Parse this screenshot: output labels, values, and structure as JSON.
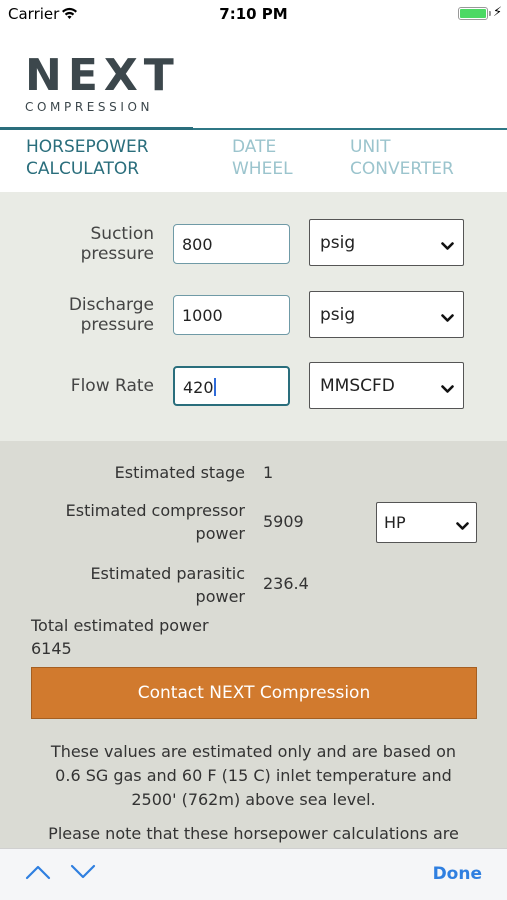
{
  "status_bar": {
    "carrier": "Carrier",
    "time": "7:10 PM",
    "charging_symbol": "⚡"
  },
  "logo": {
    "main": "NEXT",
    "sub": "COMPRESSION"
  },
  "tabs": [
    {
      "line1": "HORSEPOWER",
      "line2": "CALCULATOR",
      "active": true
    },
    {
      "line1": "DATE",
      "line2": "WHEEL",
      "active": false
    },
    {
      "line1": "UNIT",
      "line2": "CONVERTER",
      "active": false
    }
  ],
  "inputs": {
    "suction": {
      "label_line1": "Suction",
      "label_line2": "pressure",
      "value": "800",
      "unit": "psig"
    },
    "discharge": {
      "label_line1": "Discharge",
      "label_line2": "pressure",
      "value": "1000",
      "unit": "psig"
    },
    "flow": {
      "label": "Flow Rate",
      "value": "420",
      "unit": "MMSCFD"
    }
  },
  "results": {
    "stage_label": "Estimated stage",
    "stage_value": "1",
    "compressor_label_line1": "Estimated compressor",
    "compressor_label_line2": "power",
    "compressor_value": "5909",
    "power_unit": "HP",
    "parasitic_label_line1": "Estimated parasitic",
    "parasitic_label_line2": "power",
    "parasitic_value": "236.4",
    "total_label": "Total estimated power",
    "total_value": "6145",
    "contact_button": "Contact NEXT Compression",
    "disclaimer_line1": "These values are estimated only and are based on",
    "disclaimer_line2": "0.6 SG gas and 60 F (15 C) inlet temperature and",
    "disclaimer_line3": "2500' (762m) above sea level.",
    "note": "Please note that these horsepower calculations are"
  },
  "toolbar": {
    "done_label": "Done"
  },
  "colors": {
    "brand_teal": "#2a6e7c",
    "inactive_tab": "#9bc4cd",
    "accent_orange": "#d17a2e",
    "ios_blue": "#2f7fe0"
  },
  "icons": [
    "wifi-icon",
    "battery-icon",
    "chevron-down-icon",
    "chevron-up-icon"
  ]
}
